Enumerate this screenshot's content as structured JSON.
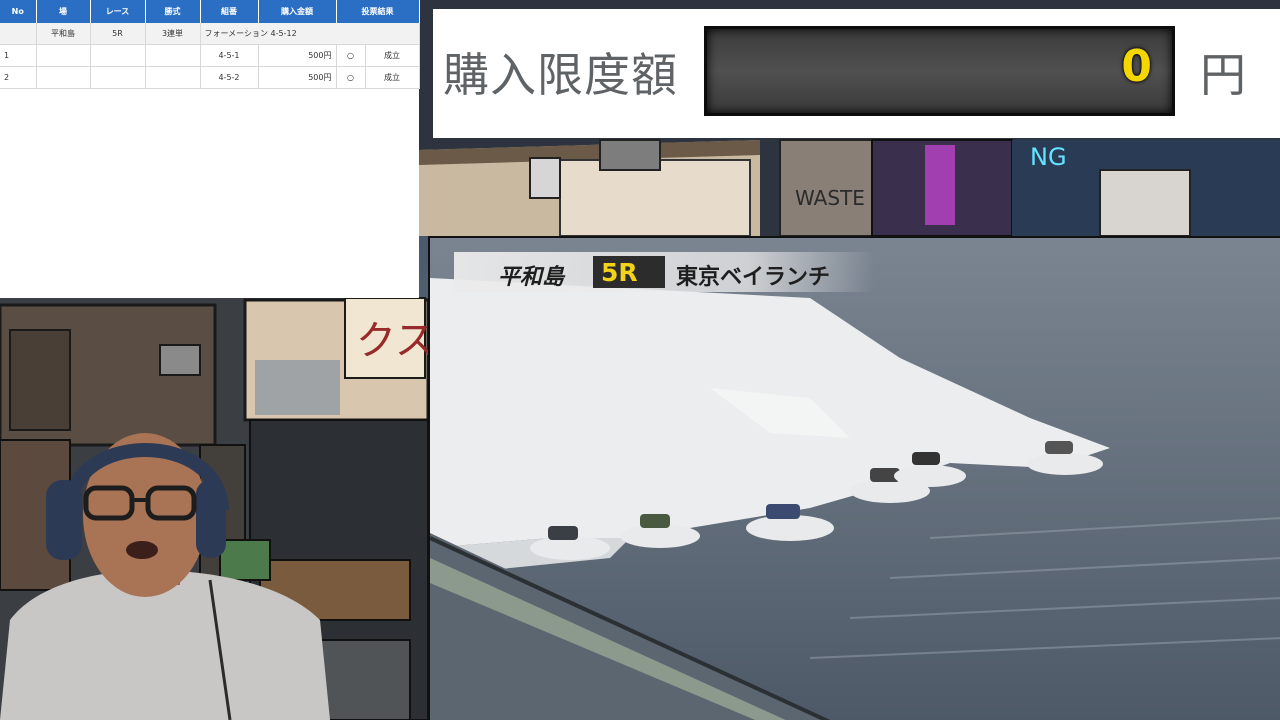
{
  "bet_table": {
    "headers": [
      "No",
      "場",
      "レース",
      "勝式",
      "組番",
      "購入金額",
      "投票結果"
    ],
    "summary": {
      "venue": "平和島",
      "race": "5R",
      "bet_type": "3連単",
      "formation": "フォーメーション 4-5-12"
    },
    "rows": [
      {
        "no": "1",
        "combo": "4-5-1",
        "amount": "500円",
        "mark": "○",
        "result": "成立"
      },
      {
        "no": "2",
        "combo": "4-5-2",
        "amount": "500円",
        "mark": "○",
        "result": "成立"
      }
    ]
  },
  "purchase_limit": {
    "label": "購入限度額",
    "value": "0",
    "unit": "円"
  },
  "race_overlay": {
    "venue": "平和島",
    "race_number": "5R",
    "race_name": "東京ベイランチ"
  },
  "background_signs": {
    "waste": "WASTE",
    "shop_katakana": "クス",
    "neon": "NG"
  },
  "colors": {
    "table_header": "#2b6fc4",
    "limit_value": "#f4d700",
    "race_number": "#f3d21a"
  }
}
